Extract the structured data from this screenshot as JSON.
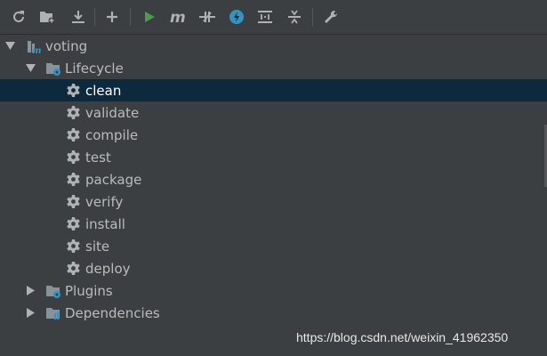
{
  "toolbar": {
    "buttons": [
      {
        "icon": "reload-icon"
      },
      {
        "icon": "add-maven-project-icon"
      },
      {
        "icon": "download-sources-icon"
      },
      {
        "icon": "plus-icon"
      },
      {
        "icon": "run-icon"
      },
      {
        "icon": "execute-maven-goal-icon"
      },
      {
        "icon": "toggle-offline-icon"
      },
      {
        "icon": "skip-tests-icon"
      },
      {
        "icon": "show-dependencies-icon"
      },
      {
        "icon": "collapse-all-icon"
      },
      {
        "icon": "settings-wrench-icon"
      }
    ]
  },
  "tree": {
    "project": "voting",
    "lifecycle": {
      "label": "Lifecycle",
      "goals": [
        "clean",
        "validate",
        "compile",
        "test",
        "package",
        "verify",
        "install",
        "site",
        "deploy"
      ],
      "selected": "clean"
    },
    "plugins": "Plugins",
    "dependencies": "Dependencies"
  },
  "watermark": "https://blog.csdn.net/weixin_41962350",
  "colors": {
    "background": "#3c3f41",
    "selection": "#0d293e",
    "text": "#bbbbbb",
    "run_green": "#499c54",
    "accent_blue": "#3592c4"
  }
}
